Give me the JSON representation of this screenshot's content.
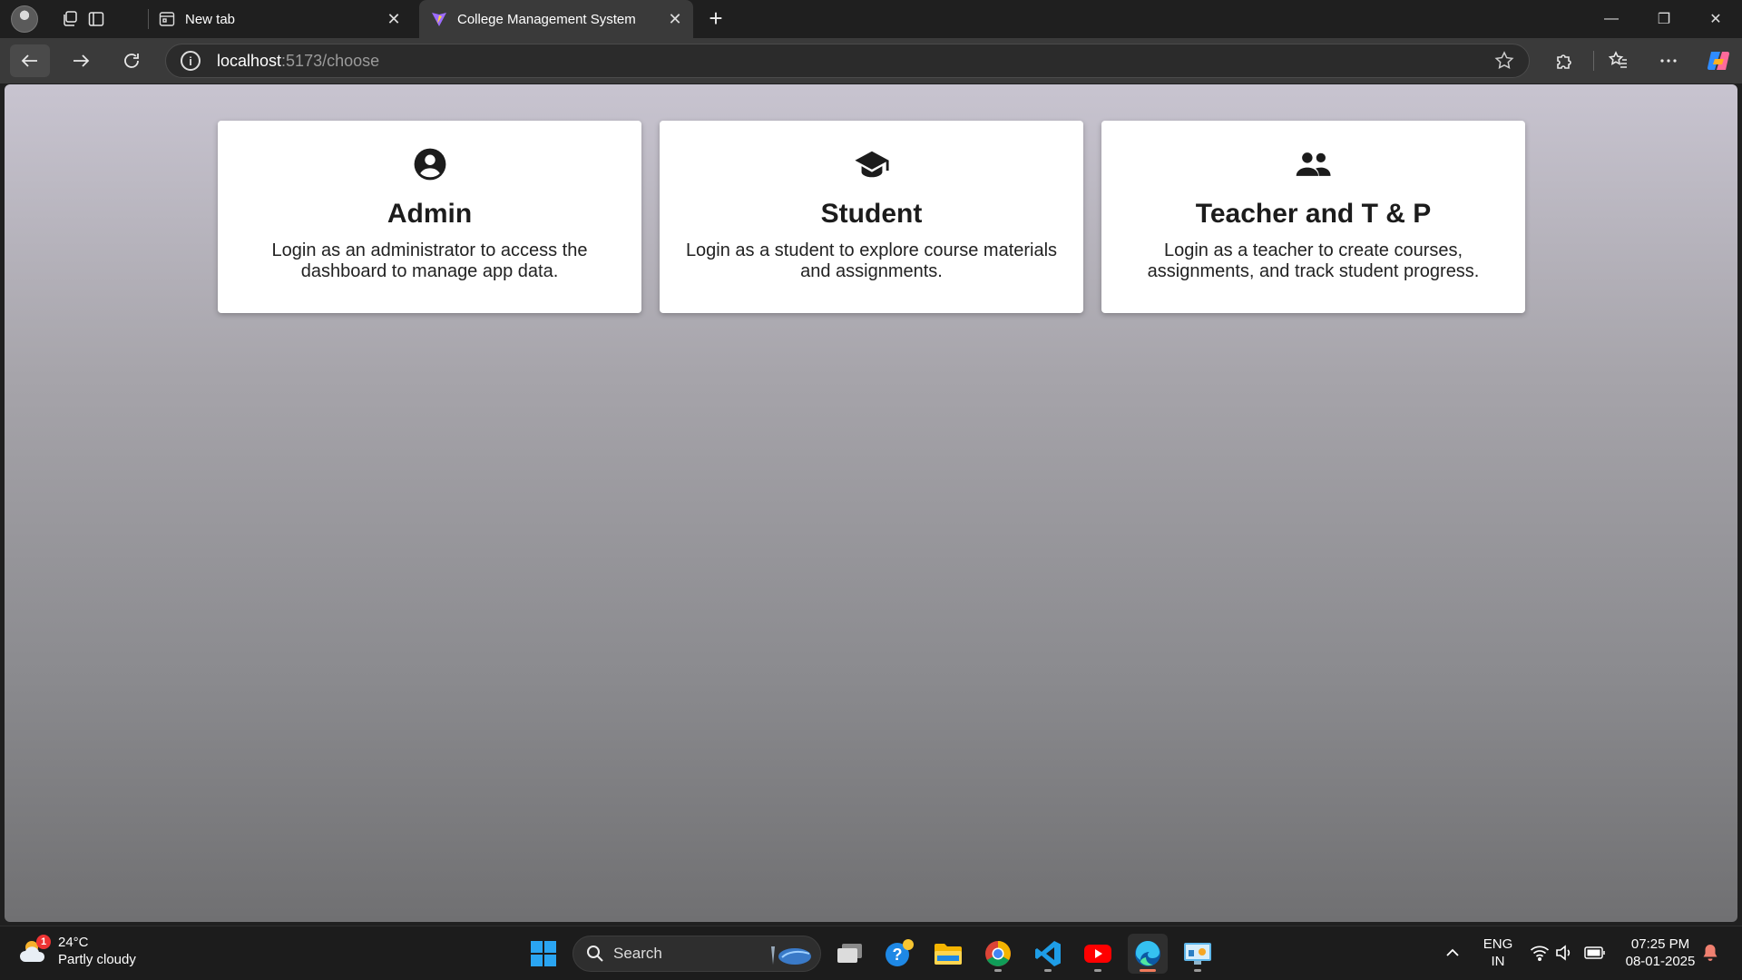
{
  "browser": {
    "tabs": [
      {
        "title": "New tab",
        "close": "✕"
      },
      {
        "title": "College Management System",
        "close": "✕"
      }
    ],
    "new_tab": "+",
    "url_host": "localhost",
    "url_rest": ":5173/choose",
    "window_controls": {
      "minimize": "—",
      "restore": "❐",
      "close": "✕"
    }
  },
  "page": {
    "cards": [
      {
        "icon": "account-circle-icon",
        "title": "Admin",
        "description": "Login as an administrator to access the dashboard to manage app data."
      },
      {
        "icon": "graduation-cap-icon",
        "title": "Student",
        "description": "Login as a student to explore course materials and assignments."
      },
      {
        "icon": "people-icon",
        "title": "Teacher and T & P",
        "description": "Login as a teacher to create courses, assignments, and track student progress."
      }
    ]
  },
  "taskbar": {
    "weather": {
      "temp": "24°C",
      "condition": "Partly cloudy",
      "badge": "1"
    },
    "search_label": "Search",
    "language": {
      "lang": "ENG",
      "region": "IN"
    },
    "clock": {
      "time": "07:25 PM",
      "date": "08-01-2025"
    }
  },
  "colors": {
    "page_gradient_top": "#c8c4d0",
    "page_gradient_bottom": "#707072",
    "card_bg": "#ffffff",
    "text_dark": "#1c1c1c",
    "edge_active": "#f07a5b"
  }
}
